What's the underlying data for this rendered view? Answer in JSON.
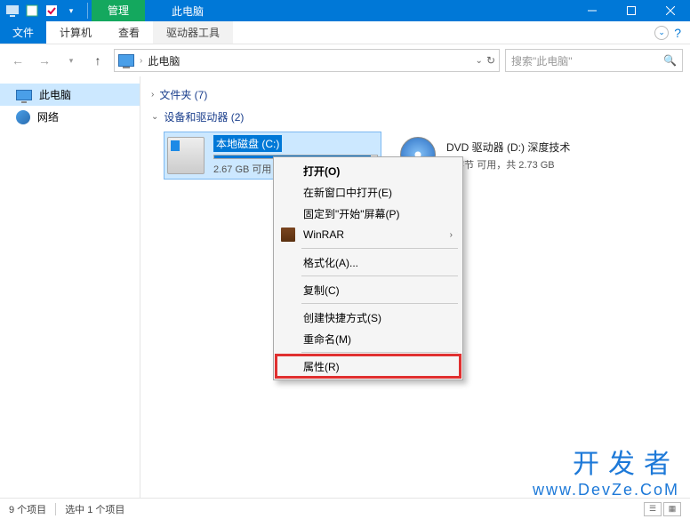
{
  "titlebar": {
    "context_tab": "管理",
    "title": "此电脑"
  },
  "ribbon": {
    "file": "文件",
    "computer": "计算机",
    "view": "查看",
    "drive_tools": "驱动器工具"
  },
  "nav": {
    "location": "此电脑",
    "search_placeholder": "搜索\"此电脑\""
  },
  "sidebar": {
    "items": [
      {
        "label": "此电脑",
        "icon": "pc",
        "selected": true
      },
      {
        "label": "网络",
        "icon": "network",
        "selected": false
      }
    ]
  },
  "content": {
    "group_folders": "文件夹 (7)",
    "group_drives": "设备和驱动器 (2)",
    "drives": [
      {
        "name": "本地磁盘 (C:)",
        "status": "2.67 GB 可用",
        "fill_percent": 96,
        "type": "hdd",
        "selected": true
      },
      {
        "name": "DVD 驱动器 (D:) 深度技术",
        "status": "0 字节 可用，共 2.73 GB",
        "type": "dvd",
        "selected": false
      }
    ]
  },
  "context_menu": {
    "items": [
      {
        "label": "打开(O)",
        "bold": true
      },
      {
        "label": "在新窗口中打开(E)"
      },
      {
        "label": "固定到\"开始\"屏幕(P)"
      },
      {
        "label": "WinRAR",
        "icon": "winrar",
        "submenu": true
      },
      {
        "sep": true
      },
      {
        "label": "格式化(A)..."
      },
      {
        "sep": true
      },
      {
        "label": "复制(C)"
      },
      {
        "sep": true
      },
      {
        "label": "创建快捷方式(S)"
      },
      {
        "label": "重命名(M)"
      },
      {
        "sep": true
      },
      {
        "label": "属性(R)",
        "highlighted": true
      }
    ]
  },
  "statusbar": {
    "count": "9 个项目",
    "selected": "选中 1 个项目"
  },
  "watermark": {
    "cn": "开发者",
    "en": "www.DevZe.CoM"
  }
}
